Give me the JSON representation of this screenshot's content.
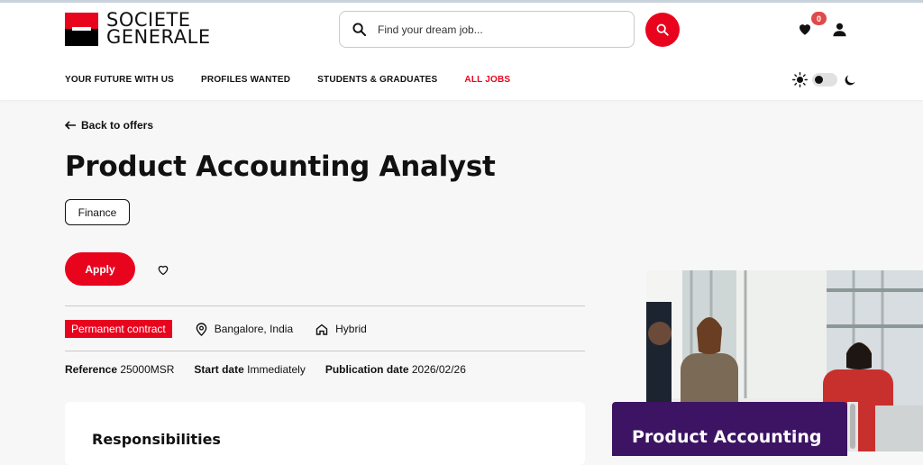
{
  "brand": {
    "line1": "SOCIETE",
    "line2": "GENERALE"
  },
  "search": {
    "placeholder": "Find your dream job..."
  },
  "header": {
    "favorites_count": "0"
  },
  "nav": {
    "items": [
      "YOUR FUTURE WITH US",
      "PROFILES WANTED",
      "STUDENTS & GRADUATES",
      "ALL JOBS"
    ],
    "active_index": 3
  },
  "back": {
    "label": "Back to offers"
  },
  "job": {
    "title": "Product Accounting Analyst",
    "category": "Finance",
    "apply_label": "Apply",
    "contract": "Permanent contract",
    "location": "Bangalore, India",
    "work_mode": "Hybrid",
    "reference_label": "Reference",
    "reference": "25000MSR",
    "start_label": "Start date",
    "start": "Immediately",
    "publication_label": "Publication date",
    "publication": "2026/02/26"
  },
  "section": {
    "responsibilities": "Responsibilities"
  },
  "promo": {
    "title": "Product Accounting"
  },
  "colors": {
    "brand_red": "#e9041e",
    "promo_purple": "#3d1363"
  }
}
